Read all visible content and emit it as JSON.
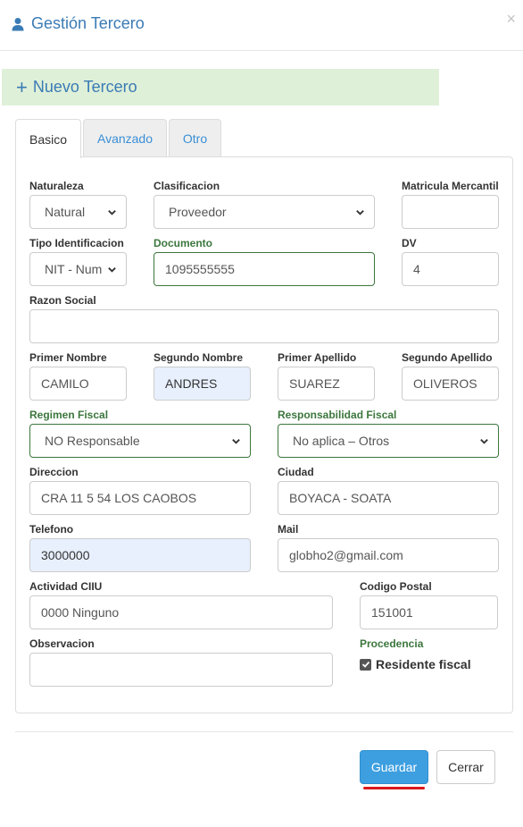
{
  "header": {
    "title": "Gestión Tercero",
    "close": "×"
  },
  "banner": {
    "plus": "+",
    "label": "Nuevo Tercero"
  },
  "tabs": [
    {
      "label": "Basico",
      "active": true
    },
    {
      "label": "Avanzado",
      "active": false
    },
    {
      "label": "Otro",
      "active": false
    }
  ],
  "form": {
    "naturaleza": {
      "label": "Naturaleza",
      "value": "Natural"
    },
    "clasificacion": {
      "label": "Clasificacion",
      "value": "Proveedor"
    },
    "matricula": {
      "label": "Matricula Mercantil",
      "value": ""
    },
    "tipo_identificacion": {
      "label": "Tipo Identificacion",
      "value": "NIT - Num"
    },
    "documento": {
      "label": "Documento",
      "value": "1095555555"
    },
    "dv": {
      "label": "DV",
      "value": "4"
    },
    "razon_social": {
      "label": "Razon Social",
      "value": ""
    },
    "primer_nombre": {
      "label": "Primer Nombre",
      "value": "CAMILO"
    },
    "segundo_nombre": {
      "label": "Segundo Nombre",
      "value": "ANDRES"
    },
    "primer_apellido": {
      "label": "Primer Apellido",
      "value": "SUAREZ"
    },
    "segundo_apellido": {
      "label": "Segundo Apellido",
      "value": "OLIVEROS"
    },
    "regimen_fiscal": {
      "label": "Regimen Fiscal",
      "value": "NO Responsable"
    },
    "responsabilidad_fiscal": {
      "label": "Responsabilidad Fiscal",
      "value": "No aplica – Otros"
    },
    "direccion": {
      "label": "Direccion",
      "value": "CRA 11 5 54 LOS CAOBOS"
    },
    "ciudad": {
      "label": "Ciudad",
      "value": "BOYACA - SOATA"
    },
    "telefono": {
      "label": "Telefono",
      "value": "3000000"
    },
    "mail": {
      "label": "Mail",
      "value": "globho2@gmail.com"
    },
    "actividad_ciiu": {
      "label": "Actividad CIIU",
      "value": "0000 Ninguno"
    },
    "codigo_postal": {
      "label": "Codigo Postal",
      "value": "151001"
    },
    "observacion": {
      "label": "Observacion",
      "value": ""
    },
    "procedencia": {
      "label": "Procedencia",
      "checkbox_label": "Residente fiscal",
      "checked": true
    }
  },
  "footer": {
    "save": "Guardar",
    "close": "Cerrar"
  },
  "colors": {
    "accent": "#3a7bb5",
    "link": "#3a8fd5",
    "valid_green": "#3c763d",
    "banner_bg": "#dff0d8",
    "primary_button": "#3d9fe0",
    "autofill_bg": "#e8f0fe",
    "annotation_red": "#d9191c"
  }
}
